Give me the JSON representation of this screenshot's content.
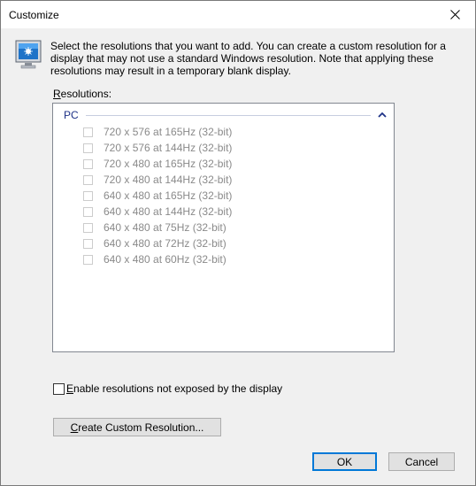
{
  "window": {
    "title": "Customize"
  },
  "description": "Select the resolutions that you want to add. You can create a custom resolution for a display that may not use a standard Windows resolution. Note that applying these resolutions may result in a temporary blank display.",
  "resolutions": {
    "label_mnemonic": "R",
    "label_rest": "esolutions:",
    "group_title": "PC",
    "items": [
      {
        "label": "720 x 576 at 165Hz (32-bit)",
        "checked": false
      },
      {
        "label": "720 x 576 at 144Hz (32-bit)",
        "checked": false
      },
      {
        "label": "720 x 480 at 165Hz (32-bit)",
        "checked": false
      },
      {
        "label": "720 x 480 at 144Hz (32-bit)",
        "checked": false
      },
      {
        "label": "640 x 480 at 165Hz (32-bit)",
        "checked": false
      },
      {
        "label": "640 x 480 at 144Hz (32-bit)",
        "checked": false
      },
      {
        "label": "640 x 480 at 75Hz (32-bit)",
        "checked": false
      },
      {
        "label": "640 x 480 at 72Hz (32-bit)",
        "checked": false
      },
      {
        "label": "640 x 480 at 60Hz (32-bit)",
        "checked": false
      }
    ]
  },
  "enable_checkbox": {
    "mnemonic": "E",
    "rest": "nable resolutions not exposed by the display",
    "checked": false
  },
  "buttons": {
    "custom_mnemonic": "C",
    "custom_rest": "reate Custom Resolution...",
    "ok": "OK",
    "cancel": "Cancel"
  },
  "icons": {
    "close": "close-icon",
    "monitor": "monitor-icon",
    "chevron": "chevron-up-icon"
  }
}
